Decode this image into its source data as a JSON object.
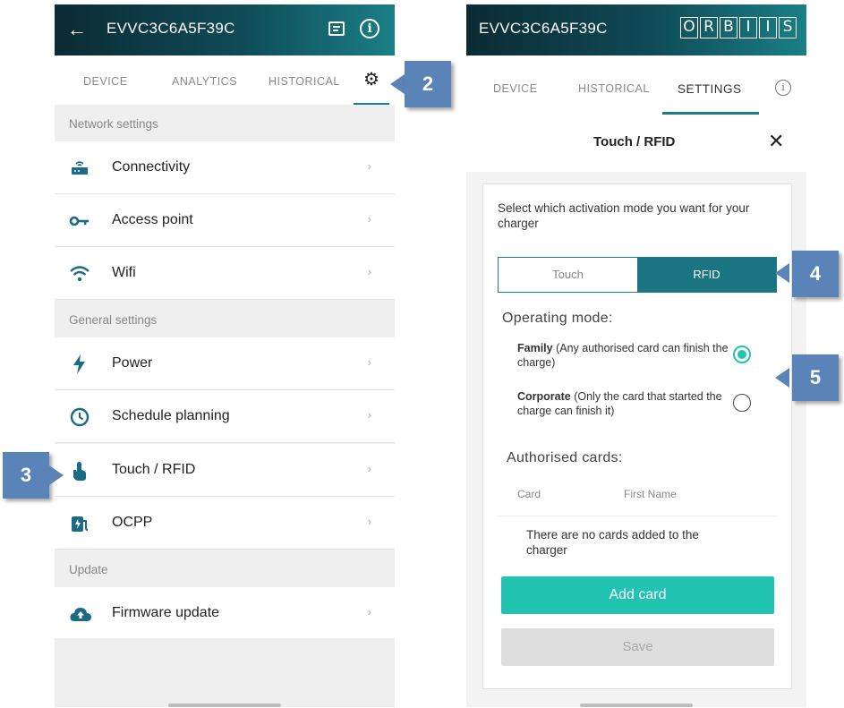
{
  "left": {
    "device_id": "EVVC3C6A5F39C",
    "tabs": [
      "DEVICE",
      "ANALYTICS",
      "HISTORICAL"
    ],
    "sections": {
      "network": "Network settings",
      "general": "General settings",
      "update": "Update"
    },
    "items": {
      "connectivity": "Connectivity",
      "access_point": "Access point",
      "wifi": "Wifi",
      "power": "Power",
      "schedule": "Schedule planning",
      "touch_rfid": "Touch / RFID",
      "ocpp": "OCPP",
      "firmware": "Firmware update"
    },
    "icons": {
      "back": "back-arrow-icon",
      "document": "document-icon",
      "info": "info-icon",
      "settings": "gear-icon"
    }
  },
  "right": {
    "device_id": "EVVC3C6A5F39C",
    "logo_letters": [
      "O",
      "R",
      "B",
      "I",
      "I",
      "S"
    ],
    "tabs": [
      "DEVICE",
      "HISTORICAL",
      "SETTINGS"
    ],
    "dialog_title": "Touch / RFID",
    "close_glyph": "✕",
    "prompt": "Select which activation mode you want for your charger",
    "segments": [
      "Touch",
      "RFID"
    ],
    "selected_segment": "RFID",
    "operating_mode_label": "Operating mode:",
    "family_bold": "Family",
    "family_rest": " (Any authorised card can finish the charge)",
    "corporate_bold": "Corporate",
    "corporate_rest": " (Only the card that started the charge can finish it)",
    "selected_mode": "Family",
    "authorised_label": "Authorised cards:",
    "columns": [
      "Card",
      "First Name"
    ],
    "empty_message": "There are no cards added to the charger",
    "add_button": "Add card",
    "save_button": "Save"
  },
  "callouts": [
    "2",
    "3",
    "4",
    "5"
  ],
  "colors": {
    "accent": "#1a7481",
    "button_teal": "#22c3b1",
    "callout": "#5a83b8"
  }
}
